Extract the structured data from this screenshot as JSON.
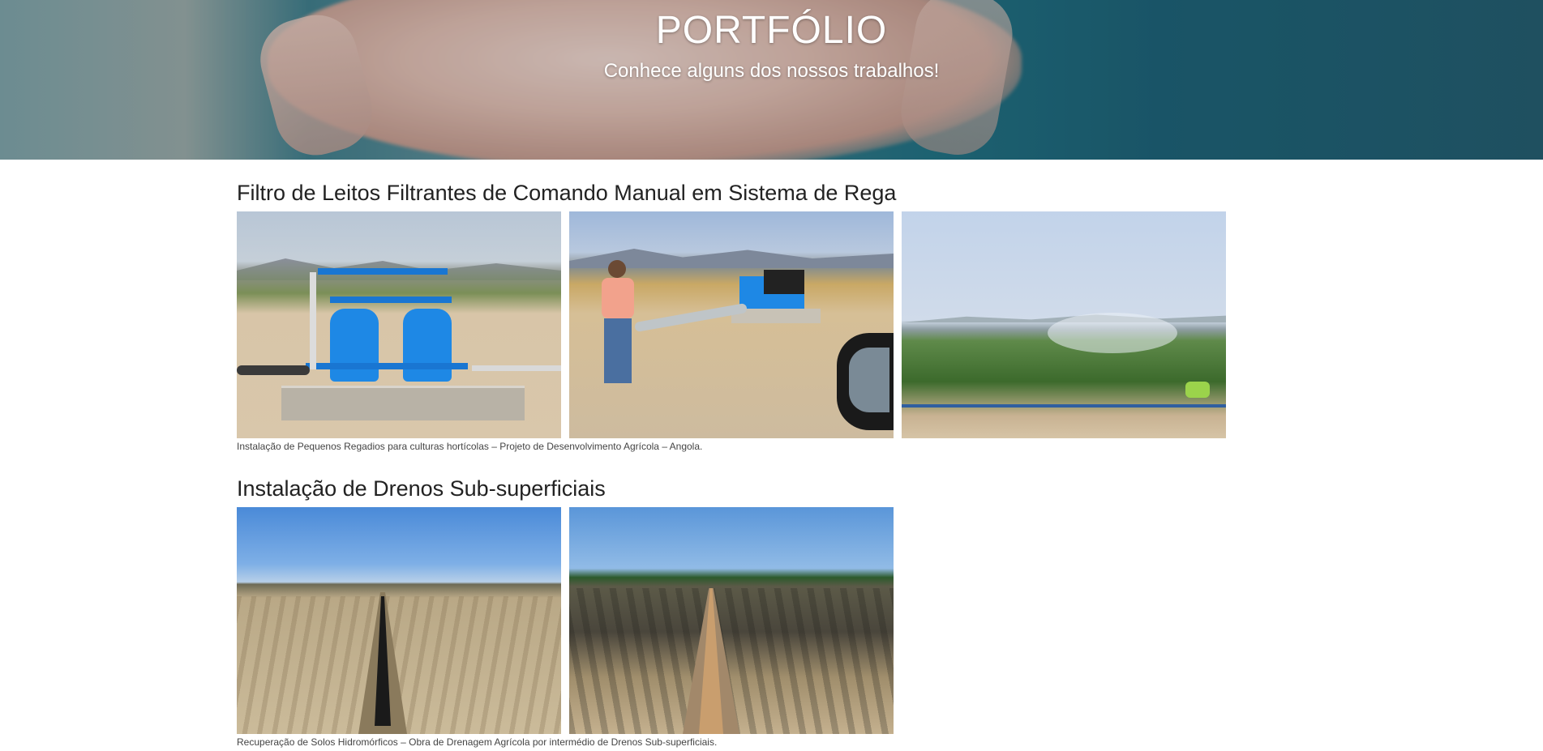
{
  "hero": {
    "title": "PORTFÓLIO",
    "subtitle": "Conhece alguns dos nossos trabalhos!"
  },
  "sections": [
    {
      "title": "Filtro de Leitos Filtrantes de Comando Manual em Sistema de Rega",
      "caption": "Instalação de Pequenos Regadios para culturas hortícolas – Projeto de Desenvolvimento Agrícola – Angola.",
      "photos": [
        "blue-sand-filters-photo",
        "water-pump-worker-photo",
        "irrigated-crop-field-photo"
      ]
    },
    {
      "title": "Instalação de Drenos Sub-superficiais",
      "caption": "Recuperação de Solos Hidromórficos – Obra de Drenagem Agrícola por intermédio de Drenos Sub-superficiais.",
      "photos": [
        "drain-trench-pipe-photo",
        "drain-trench-gravel-photo"
      ]
    }
  ]
}
